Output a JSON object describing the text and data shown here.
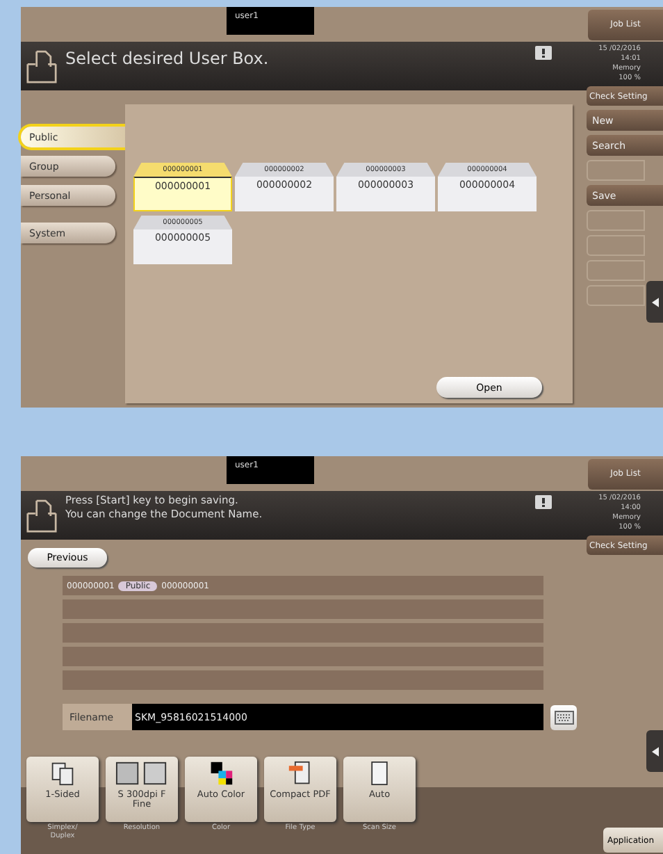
{
  "box_screen": {
    "user": "user1",
    "job_list": "Job List",
    "message": [
      "Select desired User Box."
    ],
    "date": "15 /02/2016",
    "time": "14:01",
    "memory_label": "Memory",
    "memory_value": "100 %",
    "check_setting": "Check Setting",
    "tabs": [
      {
        "label": "Public",
        "selected": true
      },
      {
        "label": "Group",
        "selected": false
      },
      {
        "label": "Personal",
        "selected": false
      },
      {
        "label": "System",
        "selected": false
      }
    ],
    "boxes": [
      {
        "number": "000000001",
        "name": "000000001",
        "selected": true
      },
      {
        "number": "000000002",
        "name": "000000002",
        "selected": false
      },
      {
        "number": "000000003",
        "name": "000000003",
        "selected": false
      },
      {
        "number": "000000004",
        "name": "000000004",
        "selected": false
      },
      {
        "number": "000000005",
        "name": "000000005",
        "selected": false
      }
    ],
    "open_button": "Open",
    "side_buttons": [
      {
        "label": "New",
        "disabled": false
      },
      {
        "label": "Search",
        "disabled": false
      },
      {
        "disabled": true
      },
      {
        "label": "Save",
        "disabled": false
      },
      {
        "disabled": true
      },
      {
        "disabled": true
      },
      {
        "disabled": true
      },
      {
        "disabled": true
      }
    ]
  },
  "save_screen": {
    "user": "user1",
    "job_list": "Job List",
    "message": [
      "Press [Start] key to begin saving.",
      "You can change the Document Name."
    ],
    "date": "15 /02/2016",
    "time": "14:00",
    "memory_label": "Memory",
    "memory_value": "100 %",
    "check_setting": "Check Setting",
    "previous_button": "Previous",
    "box_number": "000000001",
    "box_type": "Public",
    "box_name": "000000001",
    "filename_label": "Filename",
    "filename": "SKM_95816021514000",
    "functions": [
      {
        "kind": "duplex",
        "value": "1-Sided",
        "caption": "Simplex/ Duplex"
      },
      {
        "kind": "resolution",
        "value": "S 300dpi F Fine",
        "caption": "Resolution"
      },
      {
        "kind": "color",
        "value": "Auto Color",
        "caption": "Color"
      },
      {
        "kind": "filetype",
        "value": "Compact PDF",
        "caption": "File Type"
      },
      {
        "kind": "size",
        "value": "Auto",
        "caption": "Scan Size"
      }
    ],
    "application_button": "Application"
  }
}
